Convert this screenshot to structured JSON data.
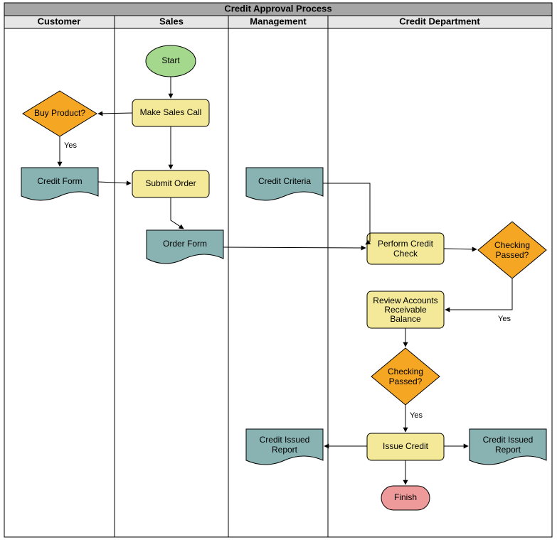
{
  "title": "Credit Approval Process",
  "lanes": {
    "customer": "Customer",
    "sales": "Sales",
    "management": "Management",
    "credit_dept": "Credit Department"
  },
  "nodes": {
    "start": "Start",
    "make_sales_call": "Make Sales Call",
    "buy_product": "Buy Product?",
    "credit_form": "Credit Form",
    "submit_order": "Submit Order",
    "order_form": "Order Form",
    "credit_criteria": "Credit Criteria",
    "perform_credit_check_l1": "Perform Credit",
    "perform_credit_check_l2": "Check",
    "checking_passed1_l1": "Checking",
    "checking_passed1_l2": "Passed?",
    "review_ar_l1": "Review Accounts",
    "review_ar_l2": "Receivable",
    "review_ar_l3": "Balance",
    "checking_passed2_l1": "Checking",
    "checking_passed2_l2": "Passed?",
    "issue_credit": "Issue Credit",
    "credit_issued_report_l1": "Credit Issued",
    "credit_issued_report_l2": "Report",
    "credit_issued_report2_l1": "Credit Issued",
    "credit_issued_report2_l2": "Report",
    "finish": "Finish"
  },
  "edge_labels": {
    "yes1": "Yes",
    "yes2": "Yes",
    "yes3": "Yes"
  },
  "chart_data": {
    "type": "swimlane-flowchart",
    "title": "Credit Approval Process",
    "lanes": [
      "Customer",
      "Sales",
      "Management",
      "Credit Department"
    ],
    "nodes": [
      {
        "id": "start",
        "lane": "Sales",
        "type": "terminator",
        "label": "Start"
      },
      {
        "id": "make_sales_call",
        "lane": "Sales",
        "type": "process",
        "label": "Make Sales Call"
      },
      {
        "id": "buy_product",
        "lane": "Customer",
        "type": "decision",
        "label": "Buy Product?"
      },
      {
        "id": "credit_form",
        "lane": "Customer",
        "type": "document",
        "label": "Credit Form"
      },
      {
        "id": "submit_order",
        "lane": "Sales",
        "type": "process",
        "label": "Submit Order"
      },
      {
        "id": "order_form",
        "lane": "Sales",
        "type": "document",
        "label": "Order Form"
      },
      {
        "id": "credit_criteria",
        "lane": "Management",
        "type": "document",
        "label": "Credit Criteria"
      },
      {
        "id": "perform_credit_check",
        "lane": "Credit Department",
        "type": "process",
        "label": "Perform Credit Check"
      },
      {
        "id": "checking_passed1",
        "lane": "Credit Department",
        "type": "decision",
        "label": "Checking Passed?"
      },
      {
        "id": "review_ar",
        "lane": "Credit Department",
        "type": "process",
        "label": "Review Accounts Receivable Balance"
      },
      {
        "id": "checking_passed2",
        "lane": "Credit Department",
        "type": "decision",
        "label": "Checking Passed?"
      },
      {
        "id": "issue_credit",
        "lane": "Credit Department",
        "type": "process",
        "label": "Issue Credit"
      },
      {
        "id": "credit_issued_report_mgmt",
        "lane": "Management",
        "type": "document",
        "label": "Credit Issued Report"
      },
      {
        "id": "credit_issued_report_cd",
        "lane": "Credit Department",
        "type": "document",
        "label": "Credit Issued Report"
      },
      {
        "id": "finish",
        "lane": "Credit Department",
        "type": "terminator",
        "label": "Finish"
      }
    ],
    "edges": [
      {
        "from": "start",
        "to": "make_sales_call"
      },
      {
        "from": "make_sales_call",
        "to": "buy_product"
      },
      {
        "from": "buy_product",
        "to": "credit_form",
        "label": "Yes"
      },
      {
        "from": "credit_form",
        "to": "submit_order"
      },
      {
        "from": "make_sales_call",
        "to": "submit_order"
      },
      {
        "from": "submit_order",
        "to": "order_form"
      },
      {
        "from": "order_form",
        "to": "perform_credit_check"
      },
      {
        "from": "credit_criteria",
        "to": "perform_credit_check"
      },
      {
        "from": "perform_credit_check",
        "to": "checking_passed1"
      },
      {
        "from": "checking_passed1",
        "to": "review_ar",
        "label": "Yes"
      },
      {
        "from": "review_ar",
        "to": "checking_passed2"
      },
      {
        "from": "checking_passed2",
        "to": "issue_credit",
        "label": "Yes"
      },
      {
        "from": "issue_credit",
        "to": "credit_issued_report_mgmt"
      },
      {
        "from": "issue_credit",
        "to": "credit_issued_report_cd"
      },
      {
        "from": "issue_credit",
        "to": "finish"
      }
    ]
  }
}
